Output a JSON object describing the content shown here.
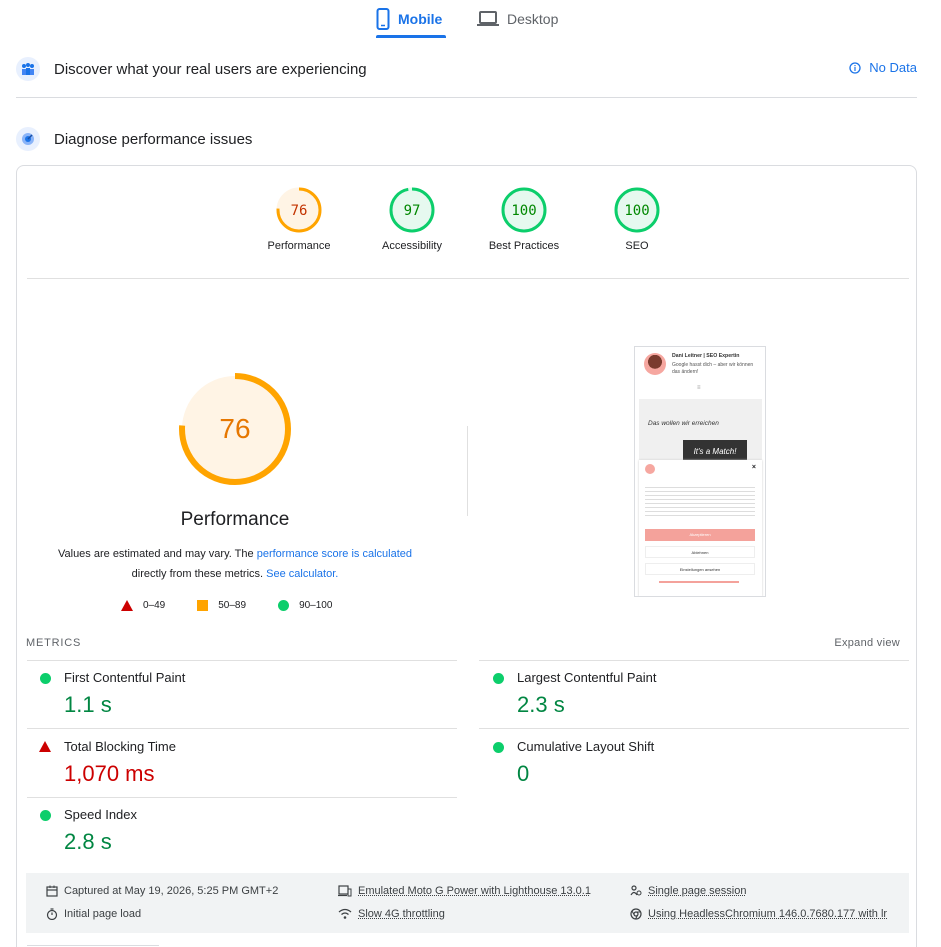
{
  "tabs": {
    "mobile": "Mobile",
    "desktop": "Desktop"
  },
  "real_users": {
    "title": "Discover what your real users are experiencing",
    "no_data": "No Data"
  },
  "diagnose": {
    "title": "Diagnose performance issues"
  },
  "scores": [
    {
      "label": "Performance",
      "value": "76",
      "color": "#ffa400"
    },
    {
      "label": "Accessibility",
      "value": "97",
      "color": "#0cce6b"
    },
    {
      "label": "Best Practices",
      "value": "100",
      "color": "#0cce6b"
    },
    {
      "label": "SEO",
      "value": "100",
      "color": "#0cce6b"
    }
  ],
  "performance": {
    "score": "76",
    "title": "Performance",
    "desc_1": "Values are estimated and may vary. The ",
    "desc_link_1": "performance score is calculated",
    "desc_2": "directly from these metrics. ",
    "desc_link_2": "See calculator."
  },
  "legend": {
    "bad": "0–49",
    "avg": "50–89",
    "good": "90–100"
  },
  "thumbnail": {
    "site_title": "Dani Leitner | SEO Expertin",
    "tagline": "Google hasst dich – aber wir können das ändern!",
    "hero_text": "Das wollen wir erreichen",
    "match_text": "It's a Match!",
    "accept": "Akzeptieren",
    "reject": "Ablehnen",
    "settings": "Einstellungen ansehen"
  },
  "metrics": {
    "label": "METRICS",
    "expand": "Expand view",
    "items": [
      {
        "name": "First Contentful Paint",
        "value": "1.1 s"
      },
      {
        "name": "Largest Contentful Paint",
        "value": "2.3 s"
      },
      {
        "name": "Total Blocking Time",
        "value": "1,070 ms"
      },
      {
        "name": "Cumulative Layout Shift",
        "value": "0"
      },
      {
        "name": "Speed Index",
        "value": "2.8 s"
      }
    ]
  },
  "footer": {
    "captured": "Captured at May 19, 2026, 5:25 PM GMT+2",
    "initial_load": "Initial page load",
    "emulated": "Emulated Moto G Power with Lighthouse 13.0.1",
    "throttling": "Slow 4G throttling",
    "session": "Single page session",
    "browser": "Using HeadlessChromium 146.0.7680.177 with lr"
  },
  "colors": {
    "accent": "#1a73e8",
    "pass": "#0cce6b",
    "average": "#ffa400",
    "fail": "#cc0000"
  }
}
